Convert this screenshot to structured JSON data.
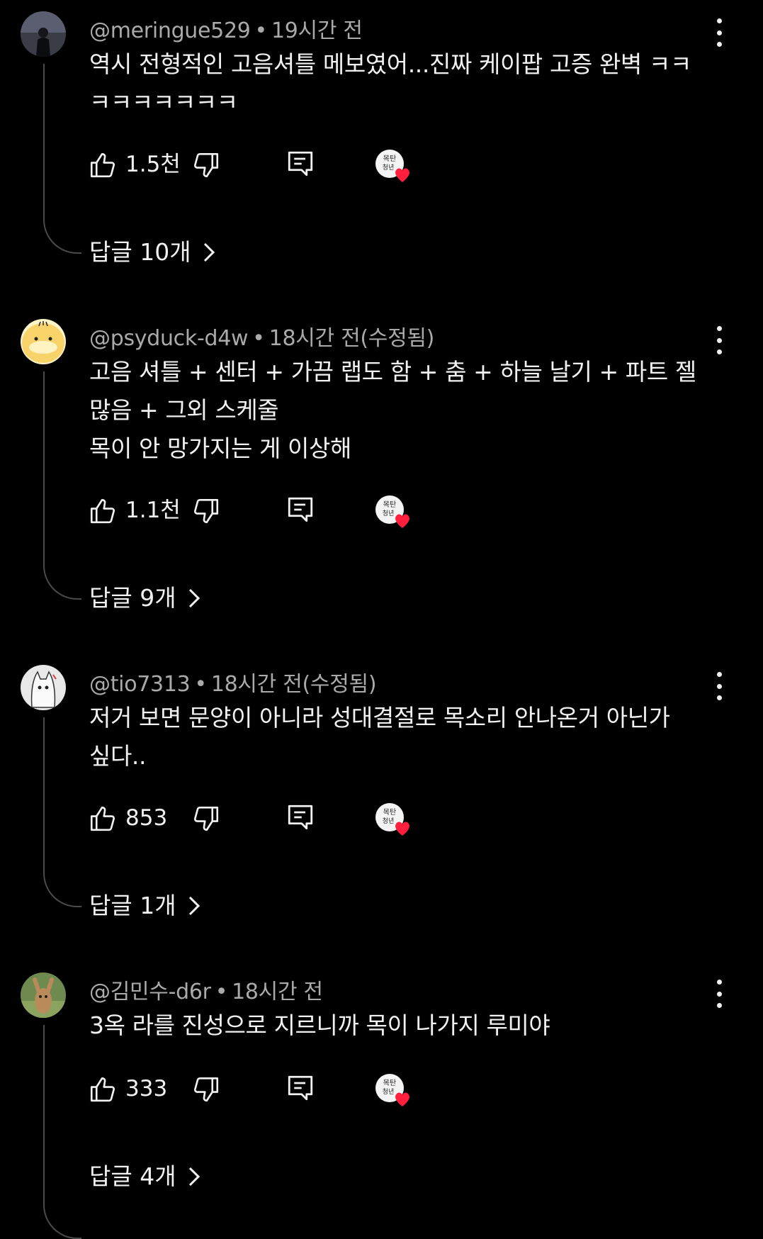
{
  "comments": [
    {
      "handle": "@meringue529",
      "separator": "•",
      "time": "19시간 전",
      "text": "역시 전형적인 고음셔틀 메보였어...진짜 케이팝 고증 완벽 ㅋㅋ\nㅋㅋㅋㅋㅋㅋㅋ",
      "likes": "1.5천",
      "replies_label": "답글 10개",
      "avatar": "dark-figure-avatar"
    },
    {
      "handle": "@psyduck-d4w",
      "separator": "•",
      "time": "18시간 전(수정됨)",
      "text": "고음 셔틀 + 센터 + 가끔 랩도 함 + 춤 + 하늘 날기 + 파트 젤\n많음 + 그외 스케줄\n목이 안 망가지는 게 이상해",
      "likes": "1.1천",
      "replies_label": "답글 9개",
      "avatar": "psyduck-avatar"
    },
    {
      "handle": "@tio7313",
      "separator": "•",
      "time": "18시간 전(수정됨)",
      "text": "저거 보면 문양이 아니라 성대결절로 목소리 안나온거 아닌가\n싶다..",
      "likes": "853",
      "replies_label": "답글 1개",
      "avatar": "ghost-cat-avatar"
    },
    {
      "handle": "@김민수-d6r",
      "separator": "•",
      "time": "18시간 전",
      "text": "3옥 라를 진성으로 지르니까 목이 나가지 루미야",
      "likes": "333",
      "replies_label": "답글 4개",
      "avatar": "kangaroo-avatar"
    }
  ],
  "creator_badge_text": "목탄 청년",
  "colors": {
    "background": "#000000",
    "text": "#f1f1f1",
    "meta": "#aaaaaa",
    "heart": "#ff1f3d"
  }
}
